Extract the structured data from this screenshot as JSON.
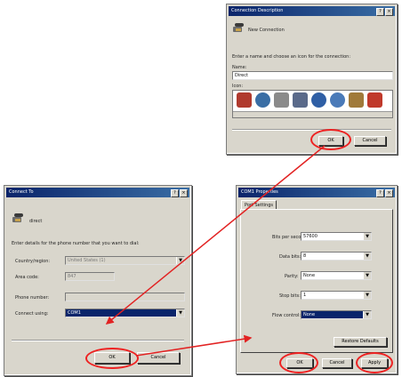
{
  "new_connection_dialog": {
    "title": "Connection Description",
    "heading": "New Connection",
    "instruction": "Enter a name and choose an icon for the connection:",
    "name_label": "Name:",
    "name_value": "Direct",
    "icon_label": "Icon:",
    "ok_label": "OK",
    "cancel_label": "Cancel"
  },
  "connect_to_dialog": {
    "title": "Connect To",
    "connection_name": "direct",
    "instruction": "Enter details for the phone number that you want to dial:",
    "country_label": "Country/region:",
    "country_value": "United States (1)",
    "area_label": "Area code:",
    "area_value": "847",
    "phone_label": "Phone number:",
    "phone_value": "",
    "connect_using_label": "Connect using:",
    "connect_using_value": "COM1",
    "ok_label": "OK",
    "cancel_label": "Cancel"
  },
  "com_properties_dialog": {
    "title": "COM1 Properties",
    "tab_label": "Port Settings",
    "bits_label": "Bits per second:",
    "bits_value": "57600",
    "data_label": "Data bits:",
    "data_value": "8",
    "parity_label": "Parity:",
    "parity_value": "None",
    "stop_label": "Stop bits:",
    "stop_value": "1",
    "flow_label": "Flow control:",
    "flow_value": "None",
    "restore_label": "Restore Defaults",
    "ok_label": "OK",
    "cancel_label": "Cancel",
    "apply_label": "Apply"
  },
  "annotation_color": "#e22222"
}
